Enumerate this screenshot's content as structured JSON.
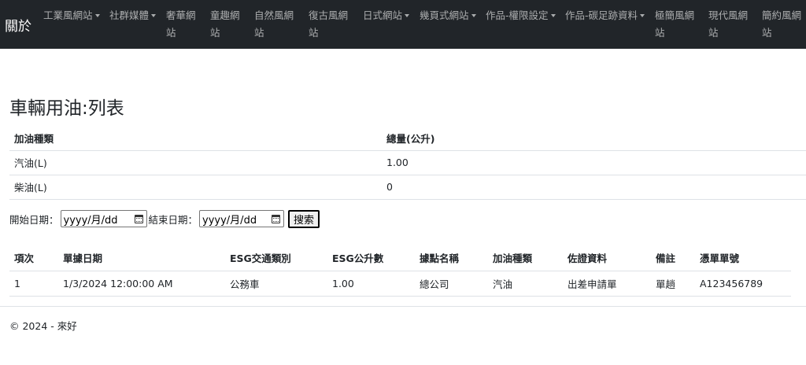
{
  "navbar": {
    "brand": "關於",
    "items": [
      {
        "label": "工業風網站",
        "dropdown": true
      },
      {
        "label": "社群媒體",
        "dropdown": true
      },
      {
        "label": "奢華網站",
        "dropdown": false
      },
      {
        "label": "童趣網站",
        "dropdown": false
      },
      {
        "label": "自然風網站",
        "dropdown": false
      },
      {
        "label": "復古風網站",
        "dropdown": false
      },
      {
        "label": "日式網站",
        "dropdown": true
      },
      {
        "label": "幾頁式網站",
        "dropdown": true
      },
      {
        "label": "作品-權限設定",
        "dropdown": true
      },
      {
        "label": "作品-碳足跡資料",
        "dropdown": true
      },
      {
        "label": "極簡風網站",
        "dropdown": false
      },
      {
        "label": "現代風網站",
        "dropdown": false
      },
      {
        "label": "簡約風網站",
        "dropdown": false
      }
    ]
  },
  "main": {
    "title": "車輛用油:列表",
    "summary": {
      "headers": [
        "加油種類",
        "總量(公升)"
      ],
      "rows": [
        [
          "汽油(L)",
          "1.00"
        ],
        [
          "柴油(L)",
          "0"
        ]
      ]
    },
    "filter": {
      "start_label": "開始日期：",
      "end_label": "結束日期：",
      "date_placeholder": "yyyy/月/dd",
      "search_label": "搜索"
    },
    "records": {
      "headers": [
        "項次",
        "單據日期",
        "ESG交通類別",
        "ESG公升數",
        "據點名稱",
        "加油種類",
        "佐證資料",
        "備註",
        "憑單單號"
      ],
      "rows": [
        [
          "1",
          "1/3/2024 12:00:00 AM",
          "公務車",
          "1.00",
          "總公司",
          "汽油",
          "出差申請單",
          "單趟",
          "A123456789"
        ]
      ]
    }
  },
  "footer": {
    "text": "© 2024 - 來好"
  }
}
